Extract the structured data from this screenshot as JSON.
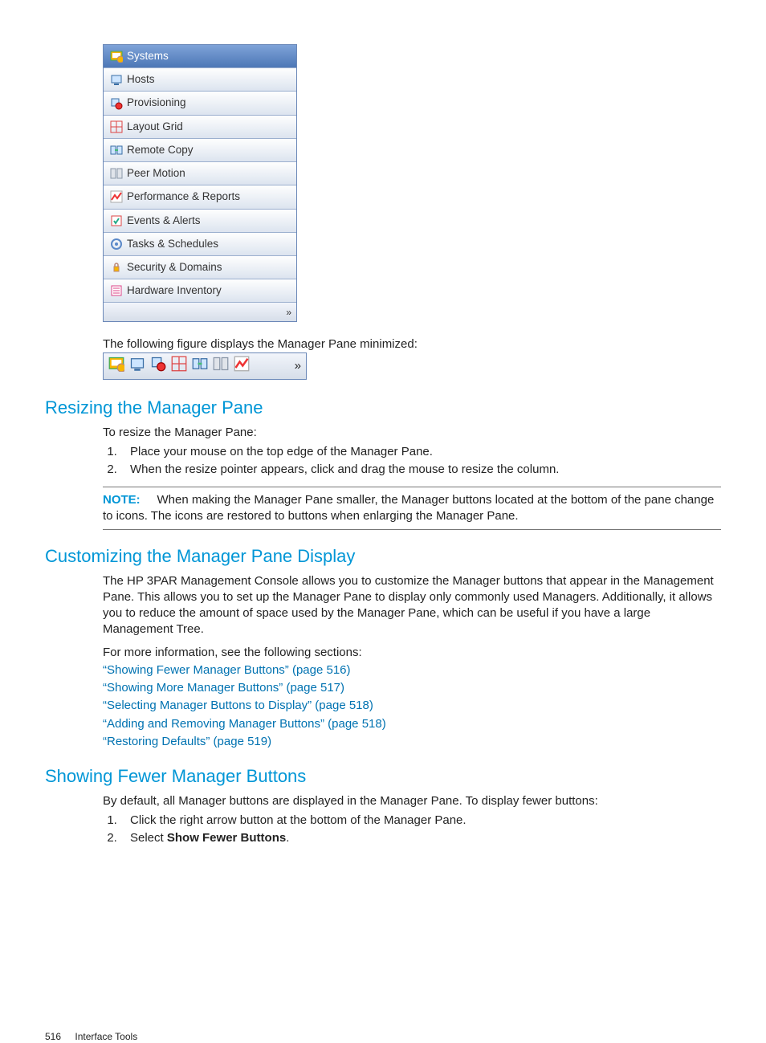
{
  "navPanel": {
    "items": [
      {
        "key": "systems",
        "label": "Systems",
        "selected": true
      },
      {
        "key": "hosts",
        "label": "Hosts"
      },
      {
        "key": "provisioning",
        "label": "Provisioning"
      },
      {
        "key": "layout-grid",
        "label": "Layout Grid"
      },
      {
        "key": "remote-copy",
        "label": "Remote Copy"
      },
      {
        "key": "peer-motion",
        "label": "Peer Motion"
      },
      {
        "key": "performance",
        "label": "Performance & Reports"
      },
      {
        "key": "events",
        "label": "Events & Alerts"
      },
      {
        "key": "tasks",
        "label": "Tasks & Schedules"
      },
      {
        "key": "security",
        "label": "Security & Domains"
      },
      {
        "key": "hardware",
        "label": "Hardware Inventory"
      }
    ],
    "expandGlyph": "»"
  },
  "captionMinimized": "The following figure displays the Manager Pane minimized:",
  "miniBar": {
    "icons": [
      "systems",
      "hosts",
      "provisioning",
      "layout-grid",
      "remote-copy",
      "peer-motion",
      "performance"
    ],
    "expandGlyph": "»"
  },
  "sectionResizing": {
    "title": "Resizing the Manager Pane",
    "intro": "To resize the Manager Pane:",
    "steps": [
      "Place your mouse on the top edge of the Manager Pane.",
      "When the resize pointer appears, click and drag the mouse to resize the column."
    ],
    "noteLabel": "NOTE:",
    "noteText": "When making the Manager Pane smaller, the Manager buttons located at the bottom of the pane change to icons. The icons are restored to buttons when enlarging the Manager Pane."
  },
  "sectionCustomizing": {
    "title": "Customizing the Manager Pane Display",
    "para": "The HP 3PAR Management Console allows you to customize the Manager buttons that appear in the Management Pane. This allows you to set up the Manager Pane to display only commonly used Managers. Additionally, it allows you to reduce the amount of space used by the Manager Pane, which can be useful if you have a large Management Tree.",
    "moreInfo": "For more information, see the following sections:",
    "links": [
      "“Showing Fewer Manager Buttons” (page 516)",
      "“Showing More Manager Buttons” (page 517)",
      "“Selecting Manager Buttons to Display” (page 518)",
      "“Adding and Removing Manager Buttons” (page 518)",
      "“Restoring Defaults” (page 519)"
    ]
  },
  "sectionFewer": {
    "title": "Showing Fewer Manager Buttons",
    "intro": "By default, all Manager buttons are displayed in the Manager Pane. To display fewer buttons:",
    "steps": [
      "Click the right arrow button at the bottom of the Manager Pane.",
      "Select <b>Show Fewer Buttons</b>."
    ],
    "step2_prefix": "Select ",
    "step2_bold": "Show Fewer Buttons",
    "step2_suffix": "."
  },
  "footer": {
    "page": "516",
    "chapter": "Interface Tools"
  }
}
